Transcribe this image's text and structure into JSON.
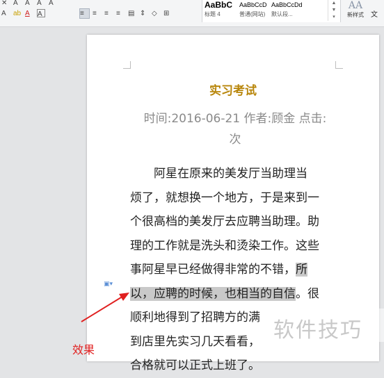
{
  "ribbon": {
    "row1": [
      "A",
      "A",
      "A",
      "ab",
      "A",
      "A"
    ],
    "row2_left": [
      "A",
      "ab",
      "A",
      "A"
    ],
    "styles": [
      {
        "sample": "AaBbC",
        "name": "标题 4"
      },
      {
        "sample": "AaBbCcD",
        "name": "普通(网站)"
      },
      {
        "sample": "AaBbCcDd",
        "name": "默认段..."
      }
    ],
    "new_style": {
      "glyph": "AA",
      "label": "新样式"
    },
    "text_tool": "文"
  },
  "document": {
    "title": "实习考试",
    "meta_line1": "时间:2016-06-21  作者:顾金  点击:",
    "meta_line2": "次",
    "lines": [
      {
        "text": "　　阿星在原来的美发厅当助理当"
      },
      {
        "text": "烦了，就想换一个地方，于是来到一"
      },
      {
        "text": "个很高档的美发厅去应聘当助理。助"
      },
      {
        "text": "理的工作就是洗头和烫染工作。这些"
      },
      {
        "before": "事阿星早已经做得非常的不错，",
        "highlight": "所",
        "after": ""
      },
      {
        "before": "",
        "highlight": "以，应聘的时候，也相当的自信",
        "after": "。很"
      },
      {
        "text": "顺利地得到了招聘方的满"
      },
      {
        "text": "到店里先实习几天看看，"
      },
      {
        "text": "合格就可以正式上班了。"
      }
    ]
  },
  "watermark": "软件技巧",
  "annotation": "效果",
  "colors": {
    "title": "#b8860b",
    "annotation": "#e02020",
    "highlight": "#c9c9c9"
  }
}
